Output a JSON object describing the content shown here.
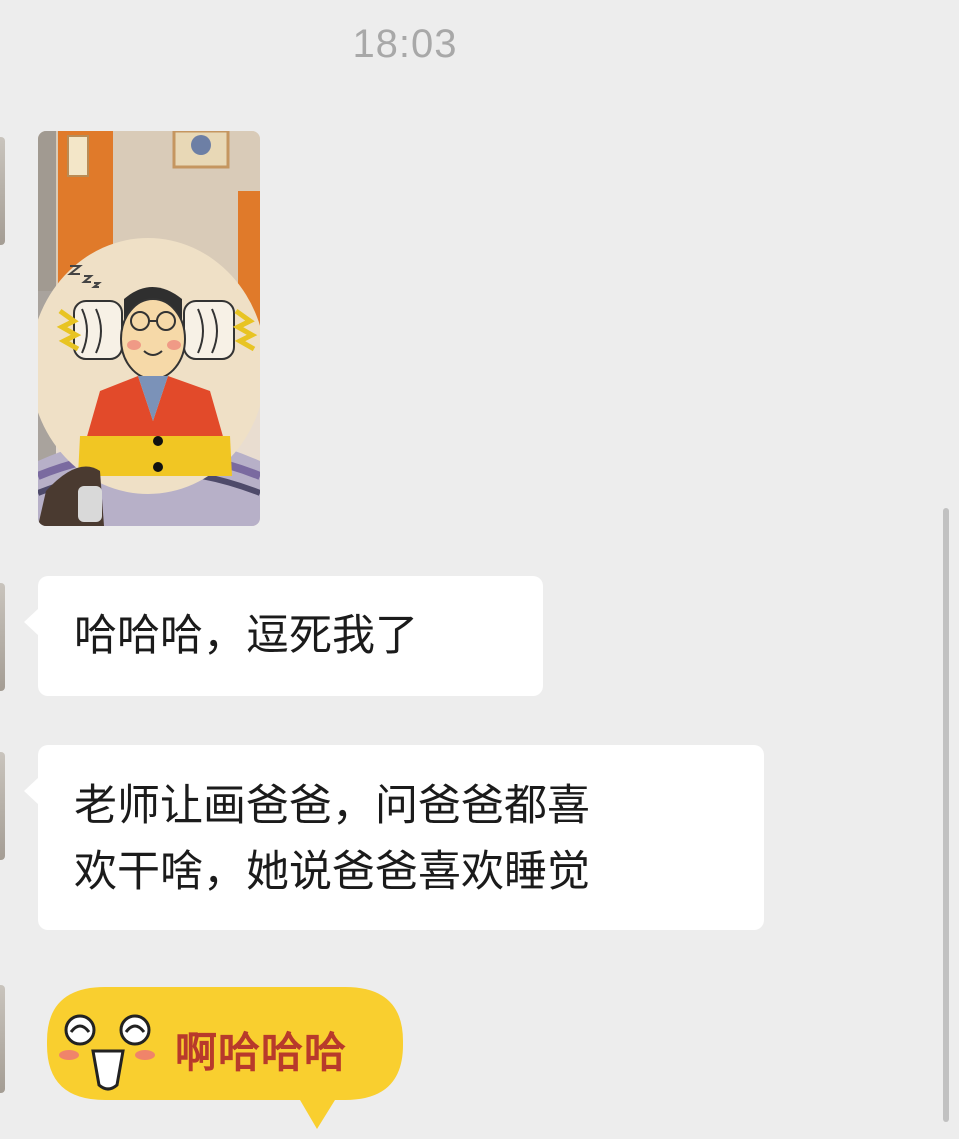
{
  "chat": {
    "timestamp": "18:03",
    "messages": [
      {
        "type": "image",
        "alt_icon": "child-drawing-photo-icon"
      },
      {
        "type": "text",
        "text": "哈哈哈，逗死我了"
      },
      {
        "type": "text",
        "lines": [
          "老师让画爸爸，问爸爸都喜",
          "欢干啥，她说爸爸喜欢睡觉"
        ]
      },
      {
        "type": "sticker",
        "text": "啊哈哈哈",
        "icon": "laughing-face-sticker-icon"
      }
    ]
  },
  "colors": {
    "background": "#ededed",
    "bubble": "#ffffff",
    "timestamp": "#a8a8a8",
    "sticker_fill": "#f9cf2f",
    "sticker_text": "#b83a2b"
  }
}
